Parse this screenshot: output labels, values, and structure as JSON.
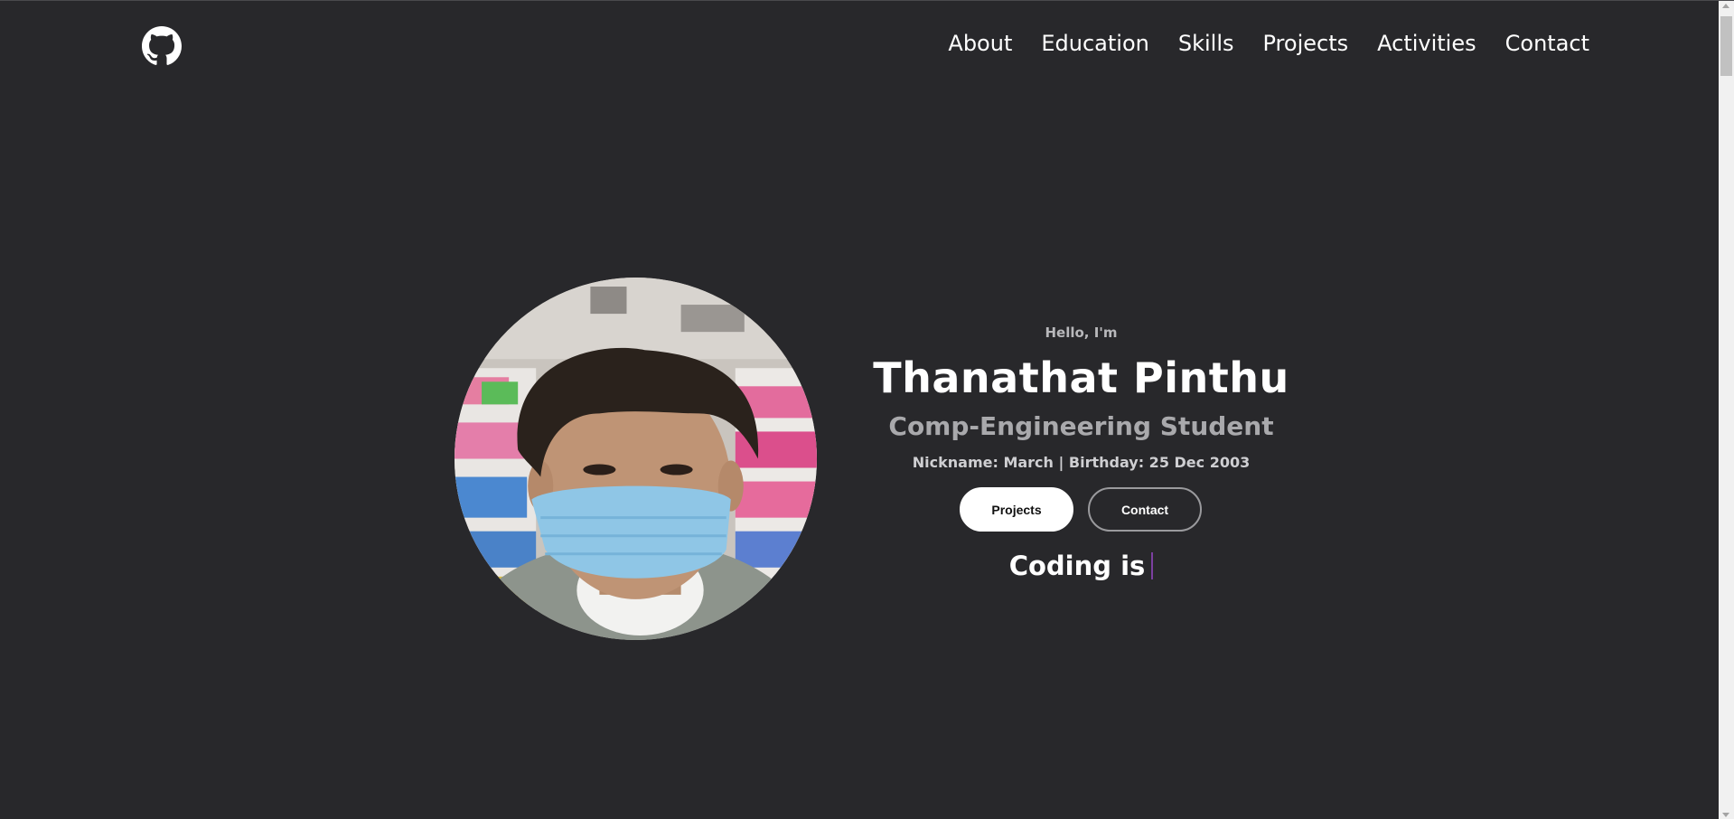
{
  "header": {
    "logo_icon": "github-icon",
    "nav": [
      {
        "label": "About"
      },
      {
        "label": "Education"
      },
      {
        "label": "Skills"
      },
      {
        "label": "Projects"
      },
      {
        "label": "Activities"
      },
      {
        "label": "Contact"
      }
    ]
  },
  "hero": {
    "greeting": "Hello, I'm",
    "name": "Thanathat Pinthu",
    "role": "Comp-Engineering Student",
    "details": "Nickname: March | Birthday: 25 Dec 2003",
    "buttons": {
      "projects": "Projects",
      "contact": "Contact"
    },
    "typing_text": "Coding is",
    "avatar_description_icon": "profile-photo"
  },
  "colors": {
    "background": "#28282b",
    "text": "#ffffff",
    "muted": "#a9a9ac",
    "cursor": "#7b3fa0"
  }
}
